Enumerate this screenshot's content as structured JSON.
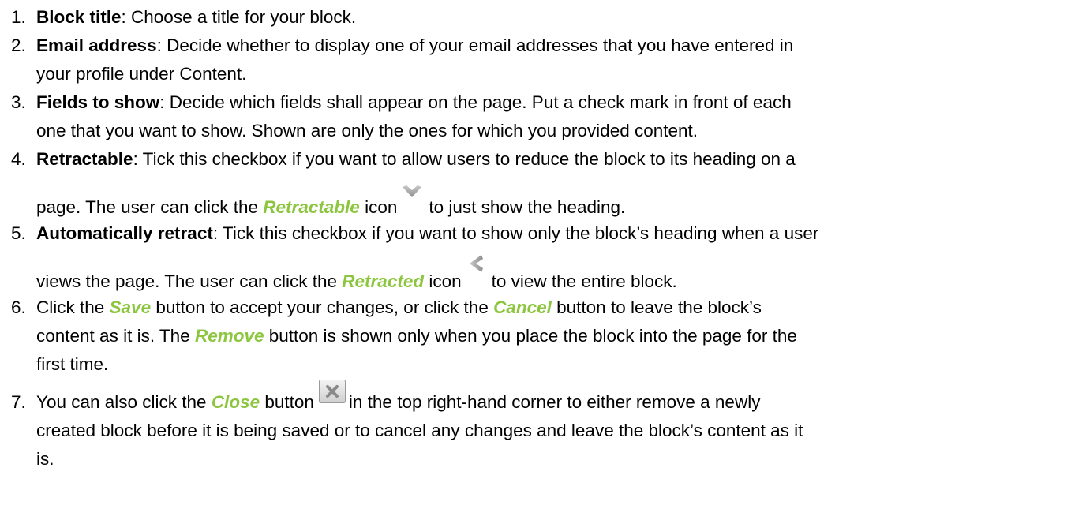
{
  "items": [
    {
      "number": "1.",
      "term": "Block title",
      "text": ": Choose a title for your block."
    },
    {
      "number": "2.",
      "term": "Email address",
      "text_line1": ": Decide whether to display one of your email addresses that you have entered in",
      "text_line2": "your profile under Content."
    },
    {
      "number": "3.",
      "term": "Fields to show",
      "text_line1": ": Decide which fields shall appear on the page. Put a check mark in front of each",
      "text_line2": "one that you want to show. Shown are only the ones for which you provided content."
    },
    {
      "number": "4.",
      "term": "Retractable",
      "text_line1": ": Tick this checkbox if you want to allow users to reduce the block to its heading on a",
      "text_line2_a": "page. The user can click the ",
      "ui_label": "Retractable",
      "text_line2_b": " icon",
      "text_line2_c": "to just show the heading.",
      "icon": "chevron-down-icon"
    },
    {
      "number": "5.",
      "term": "Automatically retract",
      "text_line1": ": Tick this checkbox if you want to show only the block’s heading when a user",
      "text_line2_a": "views the page. The user can click the ",
      "ui_label": "Retracted",
      "text_line2_b": " icon",
      "text_line2_c": "to view the entire block.",
      "icon": "chevron-left-icon"
    },
    {
      "number": "6.",
      "line1_a": "Click the ",
      "save_label": "Save",
      "line1_b": " button to accept your changes, or click the ",
      "cancel_label": "Cancel",
      "line1_c": " button to leave the block’s",
      "line2_a": "content as it is. The ",
      "remove_label": "Remove",
      "line2_b": " button is shown only when you place the block into the page for the",
      "line3": "first time."
    },
    {
      "number": "7.",
      "line1_a": "You can also click the ",
      "close_label": "Close",
      "line1_b": " button",
      "line1_c": "in the top right-hand corner to either remove a newly",
      "line2": "created block before it is being saved or to cancel any changes and leave the block’s content as it",
      "line3": "is.",
      "icon": "close-icon"
    }
  ],
  "colors": {
    "text": "#000000",
    "ui_label": "#8cc63e",
    "icon_gray": "#a9a9a9"
  }
}
